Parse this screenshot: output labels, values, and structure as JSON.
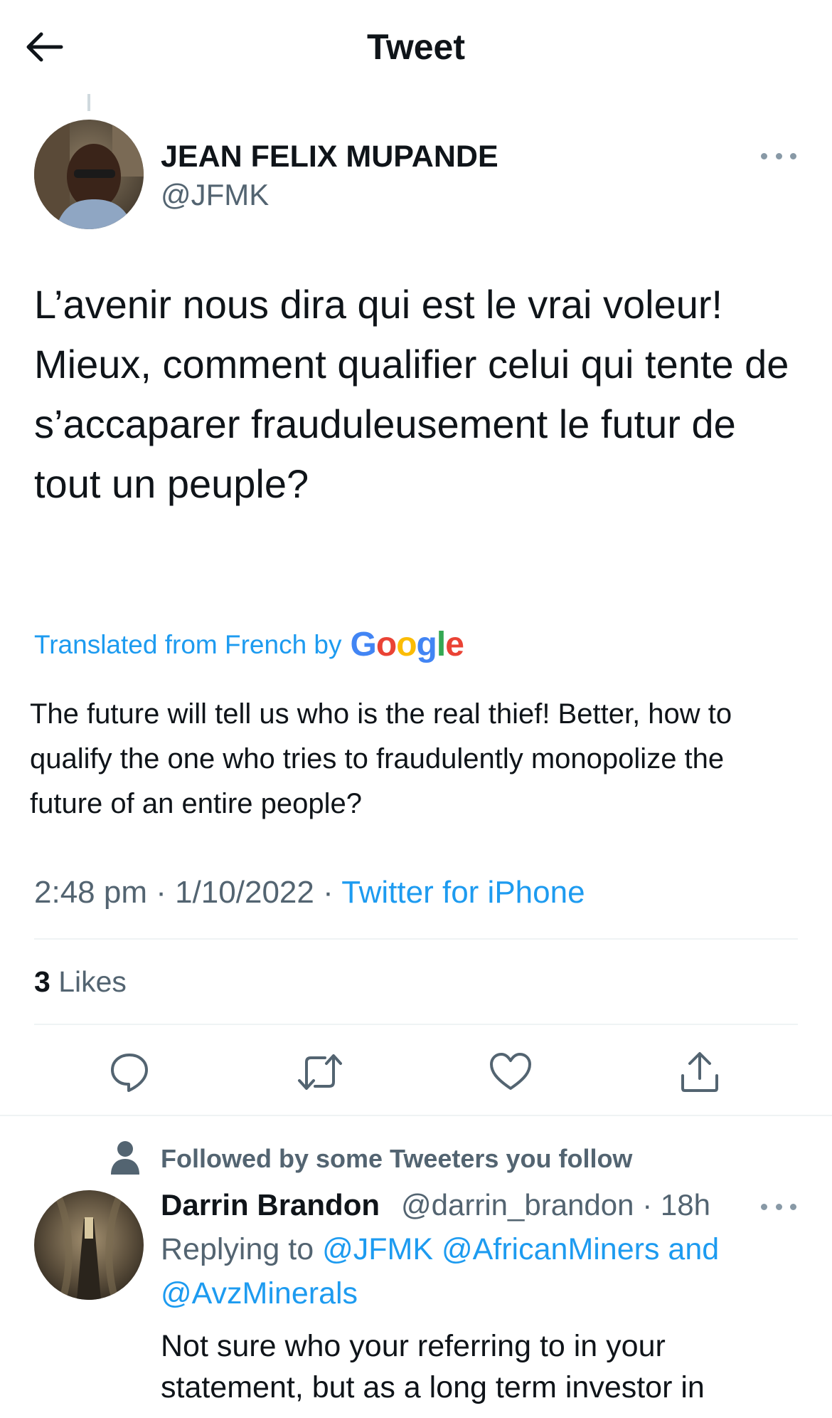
{
  "header": {
    "title": "Tweet",
    "back_icon": "arrow-left-icon"
  },
  "tweet": {
    "author_name": "JEAN FELIX MUPANDE",
    "author_handle": "@JFMK",
    "text": "L’avenir nous dira qui est le vrai voleur! Mieux, comment qualifier celui qui tente de s’accaparer frauduleusement le futur de tout un peuple?",
    "translated_label": "Translated from French by",
    "translation_provider": "Google",
    "translation": "The future will tell us who is the real thief! Better, how to qualify the one who tries to fraudulently monopolize the future of an entire people?",
    "time": "2:48 pm",
    "date": "1/10/2022",
    "source": "Twitter for iPhone",
    "separator": "·",
    "likes_count": "3",
    "likes_label": "Likes"
  },
  "actions": [
    {
      "name": "reply",
      "icon": "comment-icon"
    },
    {
      "name": "retweet",
      "icon": "retweet-icon"
    },
    {
      "name": "like",
      "icon": "heart-icon"
    },
    {
      "name": "share",
      "icon": "share-icon"
    }
  ],
  "reply": {
    "context": "Followed by some Tweeters you follow",
    "author_name": "Darrin Brandon",
    "author_handle": "@darrin_brandon",
    "time": "18h",
    "replying_label": "Replying to",
    "mentions": "@JFMK @AfricanMiners and @AvzMinerals",
    "text": "Not sure who your referring to in your statement, but as a long term investor in"
  },
  "colors": {
    "link": "#1d9bf0",
    "secondary": "#536471",
    "text": "#0f1419",
    "divider": "#eff3f4"
  }
}
